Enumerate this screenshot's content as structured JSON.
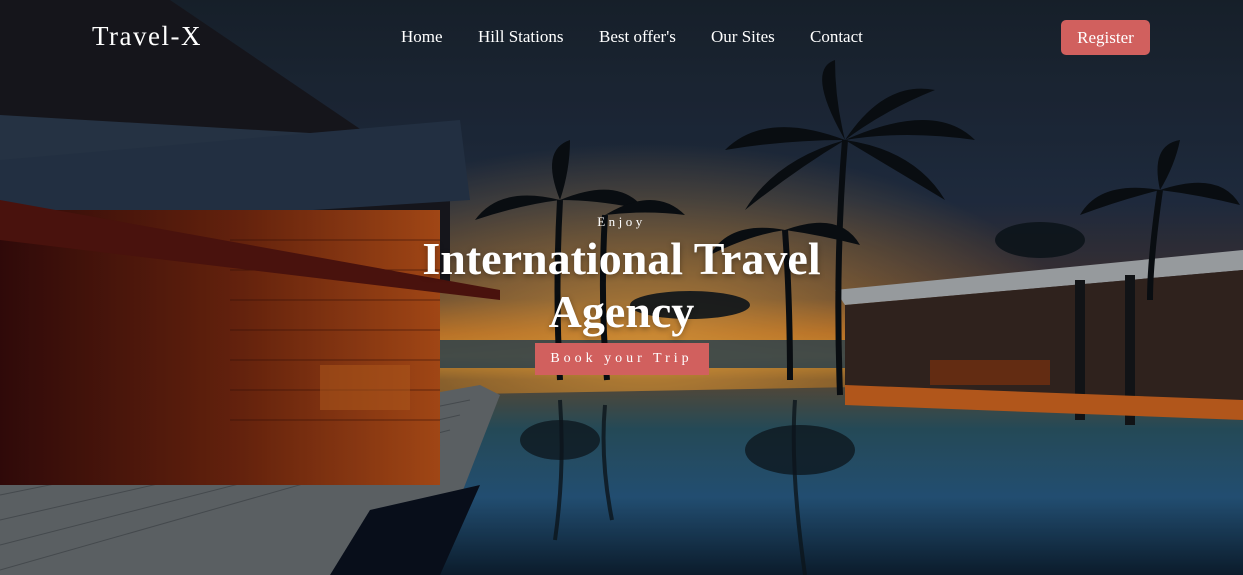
{
  "brand": {
    "name": "Travel-X"
  },
  "nav": {
    "links": [
      {
        "label": "Home"
      },
      {
        "label": "Hill Stations"
      },
      {
        "label": "Best offer's"
      },
      {
        "label": "Our Sites"
      },
      {
        "label": "Contact"
      }
    ],
    "register_label": "Register"
  },
  "hero": {
    "eyebrow": "Enjoy",
    "headline_line1": "International Travel",
    "headline_line2": "Agency",
    "cta_label": "Book your Trip",
    "background": "Sunset over a resort infinity pool with palm trees and wooden villas"
  },
  "colors": {
    "accent": "#d1605e",
    "text": "#ffffff"
  }
}
